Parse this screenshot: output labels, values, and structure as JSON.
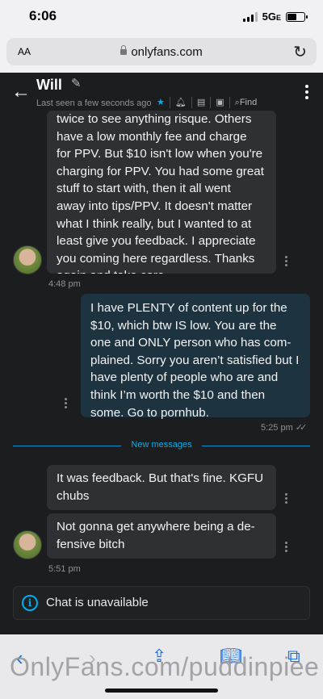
{
  "status_bar": {
    "time": "6:06",
    "network": "5G",
    "network_suffix": "E"
  },
  "browser": {
    "aa_label": "AA",
    "url": "onlyfans.com"
  },
  "chat_header": {
    "name": "Will",
    "last_seen": "Last seen a few seconds ago",
    "find_label": "Find"
  },
  "messages": [
    {
      "direction": "in",
      "text": "twice to see anything risque. Others\nhave a low monthly fee and charge\nfor PPV. But $10 isn't low when you're\ncharging for PPV. You had some great\nstuff to start with, then it all went\naway into tips/PPV. It doesn't matter\nwhat I think really, but I wanted to at\nleast give you feedback. I appreciate\nyou coming here regardless. Thanks\nagain and take care.",
      "time": "4:48 pm"
    },
    {
      "direction": "out",
      "text": "I have PLENTY of content up for the\n$10, which btw IS low. You are the\none and ONLY person who has com-\nplained. Sorry you aren’t satisfied but I\nhave plenty of people who are and\nthink I’m worth the $10 and then\nsome. Go to pornhub.",
      "time": "5:25 pm"
    },
    {
      "direction": "in",
      "text": "It was feedback. But that's fine. KGFU\nchubs"
    },
    {
      "direction": "in",
      "text": "Not gonna get anywhere being a de-\nfensive bitch",
      "time": "5:51 pm"
    }
  ],
  "new_messages_label": "New messages",
  "chat_unavailable": "Chat is unavailable",
  "watermark": "OnlyFans.com/puddinpiee",
  "colors": {
    "accent": "#00aff0",
    "incoming_bubble": "#2e3033",
    "outgoing_bubble": "#1e3340",
    "background": "#1c1d1f"
  }
}
